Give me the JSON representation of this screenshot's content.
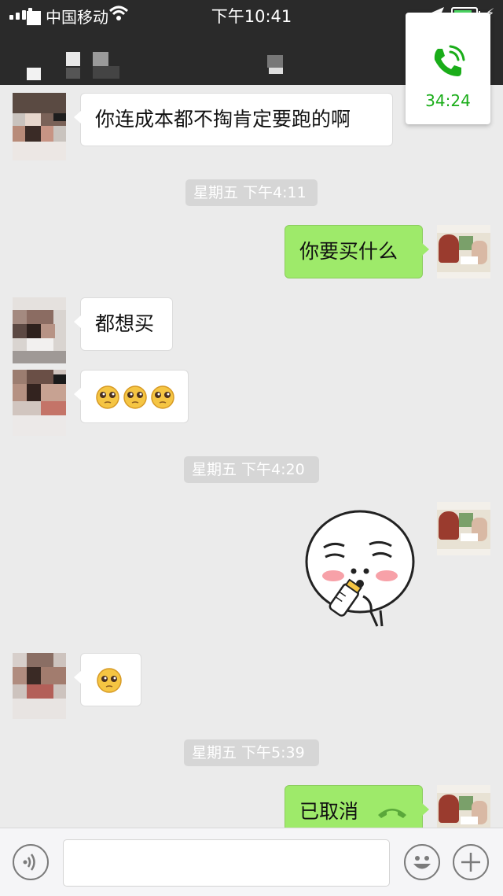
{
  "status_bar": {
    "carrier": "中国移动",
    "time": "下午10:41"
  },
  "call_widget": {
    "duration": "34:24",
    "accent_color": "#1aad19",
    "icon": "phone-ringing-icon"
  },
  "messages": [
    {
      "type": "text",
      "side": "in",
      "text": "你连成本都不掏肯定要跑的啊"
    },
    {
      "type": "timestamp",
      "text": "星期五 下午4:11"
    },
    {
      "type": "text",
      "side": "out",
      "text": "你要买什么"
    },
    {
      "type": "text",
      "side": "in",
      "text": "都想买"
    },
    {
      "type": "emoji",
      "side": "in",
      "icon": "pleading-face-emoji x3"
    },
    {
      "type": "timestamp",
      "text": "星期五 下午4:20"
    },
    {
      "type": "sticker",
      "side": "out",
      "icon": "baby-bottle-face-sticker"
    },
    {
      "type": "emoji",
      "side": "in",
      "icon": "pleading-face-emoji"
    },
    {
      "type": "timestamp",
      "text": "星期五 下午5:39"
    },
    {
      "type": "call",
      "side": "out",
      "text": "已取消",
      "icon": "phone-hangup-icon"
    }
  ],
  "input_bar": {
    "voice_icon": "voice-icon",
    "emoji_icon": "emoji-icon",
    "more_icon": "plus-icon"
  },
  "colors": {
    "header": "#2a2a2a",
    "background": "#ebebeb",
    "out_bubble": "#9eea6a",
    "in_bubble": "#ffffff"
  }
}
